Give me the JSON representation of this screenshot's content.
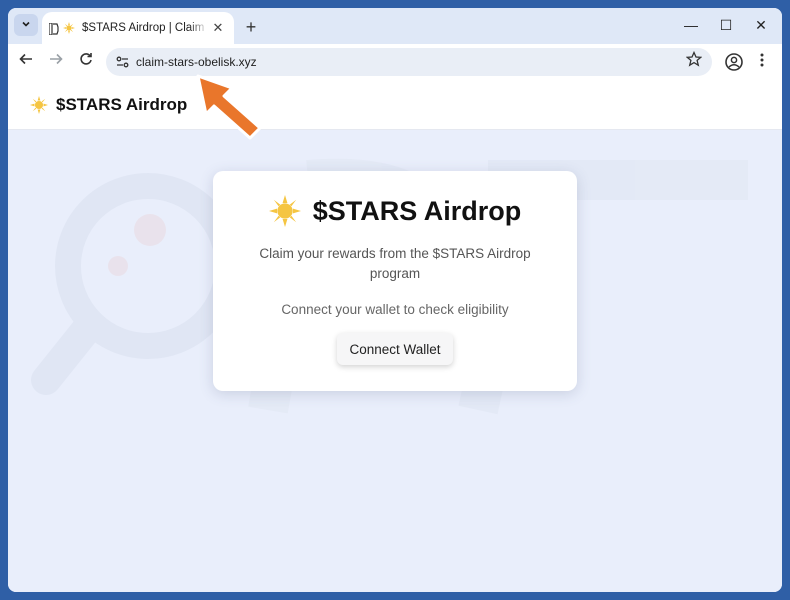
{
  "browser": {
    "tab_title": "$STARS Airdrop | Claim You",
    "tab_close": "✕",
    "new_tab": "+",
    "window_controls": {
      "minimize": "—",
      "maximize": "☐",
      "close": "✕"
    },
    "url": "claim-stars-obelisk.xyz"
  },
  "site": {
    "header_title": "$STARS Airdrop"
  },
  "card": {
    "title": "$STARS Airdrop",
    "subtitle": "Claim your rewards from the $STARS Airdrop program",
    "connect_text": "Connect your wallet to check eligibility",
    "connect_button": "Connect Wallet"
  },
  "colors": {
    "browser_frame": "#dfe8f7",
    "page_bg": "#e9eefb",
    "sun_yellow": "#f5c542",
    "arrow_orange": "#e9762b"
  },
  "icons": {
    "favicon": "sun-icon",
    "arrow": "orange-pointer-arrow-icon"
  }
}
